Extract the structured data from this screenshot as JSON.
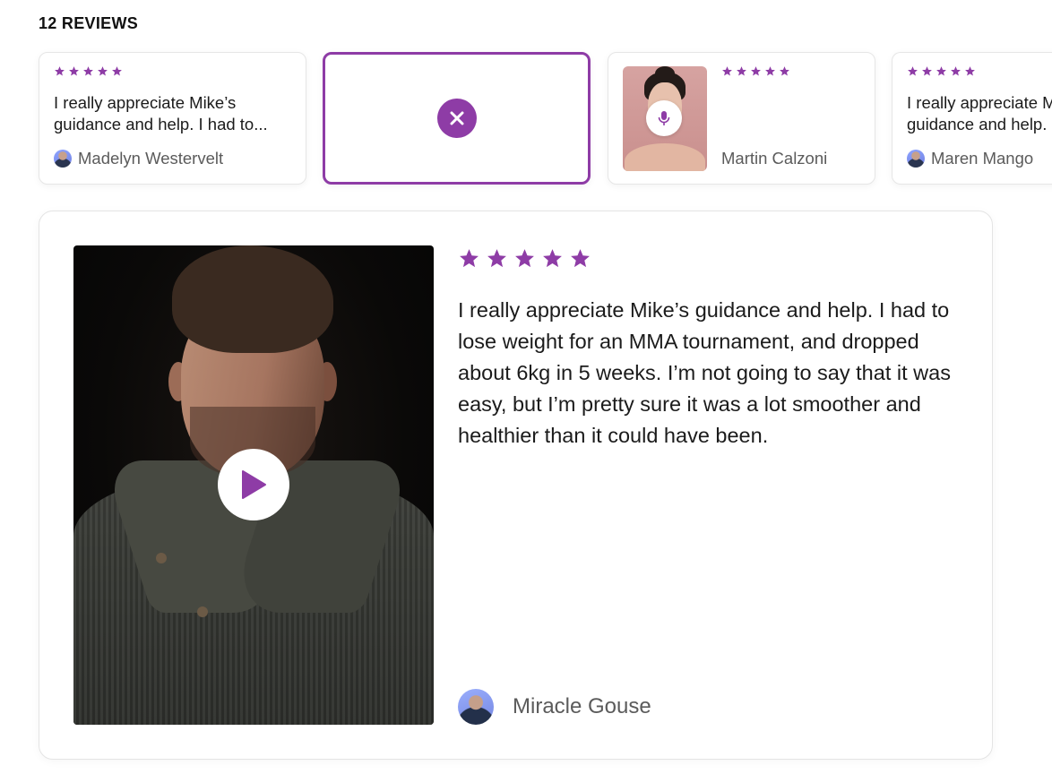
{
  "header": {
    "reviews_count": "12 REVIEWS"
  },
  "colors": {
    "accent": "#8e3ca6",
    "muted_text": "#5b5b5b"
  },
  "cards": [
    {
      "rating": 5,
      "text_lines": [
        "I really appreciate Mike’s",
        "guidance and help. I had to..."
      ],
      "author": "Madelyn Westervelt",
      "media": "none"
    },
    {
      "state": "selected",
      "icon": "close-icon"
    },
    {
      "rating": 5,
      "author": "Martin Calzoni",
      "media": "audio",
      "icon": "mic-icon"
    },
    {
      "rating": 5,
      "text_lines": [
        "I really appreciate Mike’s",
        "guidance and help. I had to..."
      ],
      "author": "Maren Mango",
      "media": "none"
    }
  ],
  "main_review": {
    "rating": 5,
    "text": "I really appreciate Mike’s guidance and help. I had to lose weight for an MMA tournament, and dropped about 6kg in 5 weeks. I’m not going to say that it was easy, but I’m pretty sure it was a lot smoother and healthier than it could have been.",
    "author": "Miracle Gouse",
    "media": "video",
    "play_icon": "play-icon"
  }
}
